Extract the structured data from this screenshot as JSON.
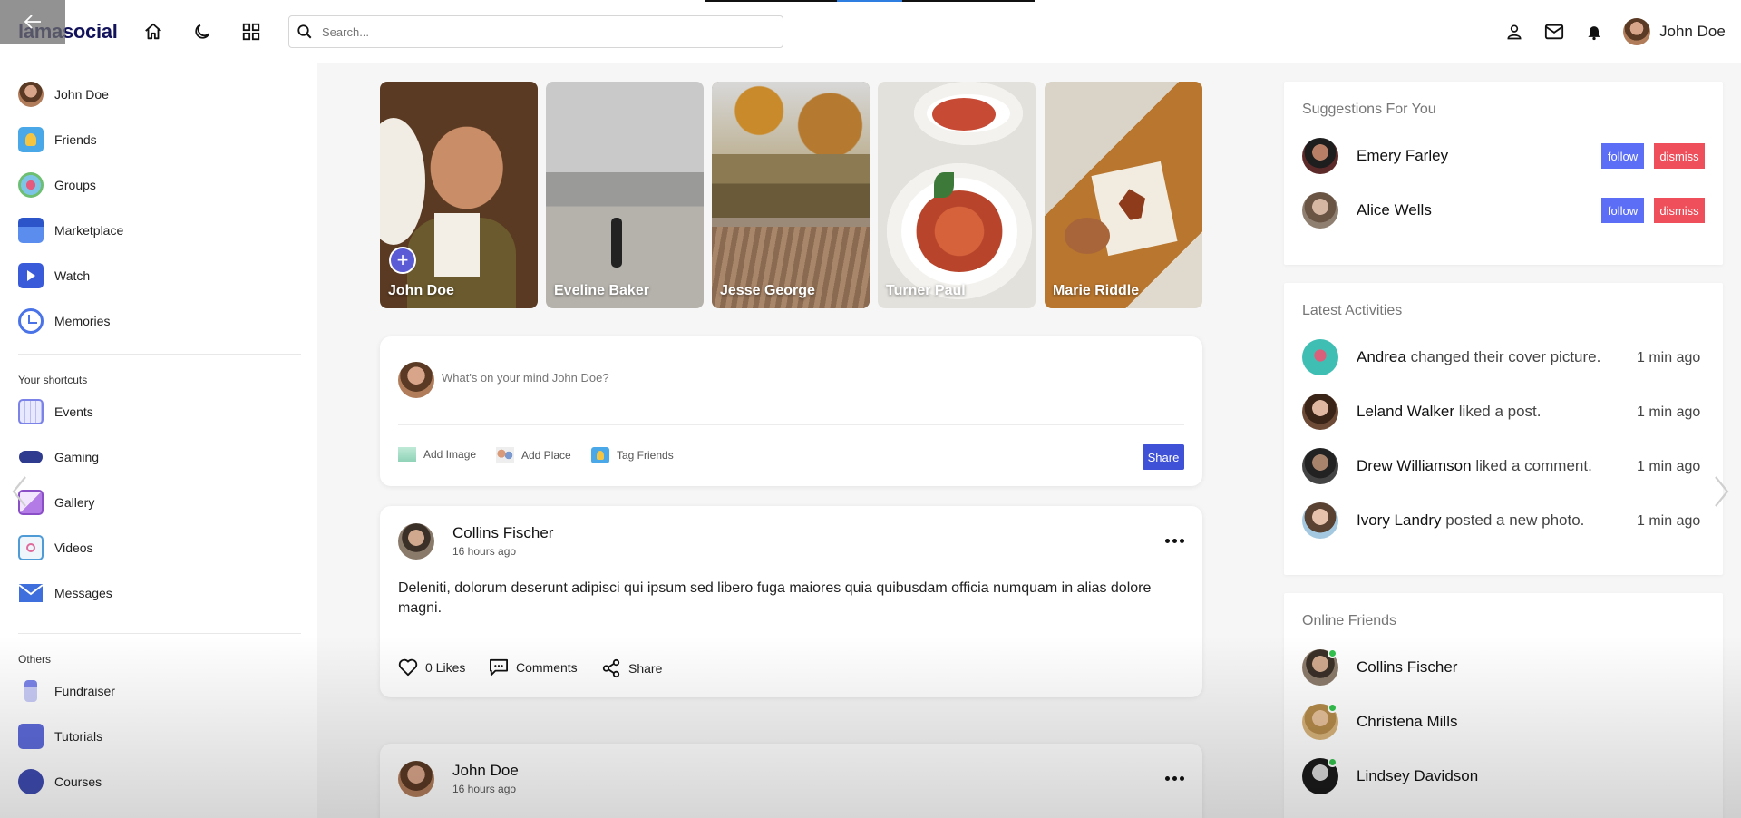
{
  "header": {
    "logo": "lamasocial",
    "search_placeholder": "Search...",
    "username": "John Doe"
  },
  "sidebar": {
    "items": [
      {
        "label": "John Doe",
        "icon": "avatar"
      },
      {
        "label": "Friends",
        "icon": "friends-icon"
      },
      {
        "label": "Groups",
        "icon": "groups-icon"
      },
      {
        "label": "Marketplace",
        "icon": "marketplace-icon"
      },
      {
        "label": "Watch",
        "icon": "watch-icon"
      },
      {
        "label": "Memories",
        "icon": "memories-icon"
      }
    ],
    "shortcuts_title": "Your shortcuts",
    "shortcuts": [
      {
        "label": "Events",
        "icon": "events-icon"
      },
      {
        "label": "Gaming",
        "icon": "gaming-icon"
      },
      {
        "label": "Gallery",
        "icon": "gallery-icon"
      },
      {
        "label": "Videos",
        "icon": "videos-icon"
      },
      {
        "label": "Messages",
        "icon": "messages-icon"
      }
    ],
    "others_title": "Others",
    "others": [
      {
        "label": "Fundraiser",
        "icon": "fundraiser-icon"
      },
      {
        "label": "Tutorials",
        "icon": "tutorials-icon"
      },
      {
        "label": "Courses",
        "icon": "courses-icon"
      }
    ]
  },
  "stories": [
    {
      "name": "John Doe"
    },
    {
      "name": "Eveline Baker"
    },
    {
      "name": "Jesse George"
    },
    {
      "name": "Turner Paul"
    },
    {
      "name": "Marie Riddle"
    }
  ],
  "composer": {
    "placeholder": "What's on your mind John Doe?",
    "add_image": "Add Image",
    "add_place": "Add Place",
    "tag_friends": "Tag Friends",
    "share": "Share"
  },
  "posts": [
    {
      "author": "Collins Fischer",
      "time": "16 hours ago",
      "text": "Deleniti, dolorum deserunt adipisci qui ipsum sed libero fuga maiores quia quibusdam officia numquam in alias dolore magni.",
      "likes": "0 Likes",
      "comments": "Comments",
      "share": "Share"
    },
    {
      "author": "John Doe",
      "time": "16 hours ago"
    }
  ],
  "suggestions": {
    "title": "Suggestions For You",
    "follow": "follow",
    "dismiss": "dismiss",
    "people": [
      {
        "name": "Emery Farley"
      },
      {
        "name": "Alice Wells"
      }
    ]
  },
  "activities": {
    "title": "Latest Activities",
    "items": [
      {
        "name": "Andrea",
        "action": "changed their cover picture.",
        "time": "1 min ago"
      },
      {
        "name": "Leland Walker",
        "action": "liked a post.",
        "time": "1 min ago"
      },
      {
        "name": "Drew Williamson",
        "action": "liked a comment.",
        "time": "1 min ago"
      },
      {
        "name": "Ivory Landry",
        "action": "posted a new photo.",
        "time": "1 min ago"
      }
    ]
  },
  "online": {
    "title": "Online Friends",
    "friends": [
      {
        "name": "Collins Fischer"
      },
      {
        "name": "Christena Mills"
      },
      {
        "name": "Lindsey Davidson"
      }
    ]
  }
}
